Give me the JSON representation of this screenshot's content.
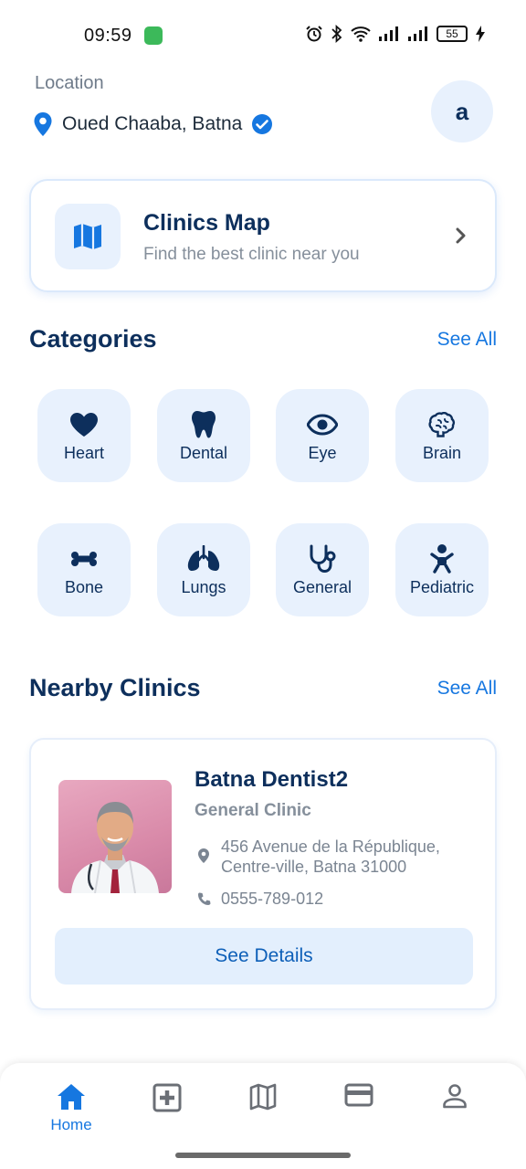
{
  "status_bar": {
    "time": "09:59",
    "battery": "55"
  },
  "header": {
    "location_label": "Location",
    "location_value": "Oued Chaaba, Batna",
    "avatar_initial": "a"
  },
  "map_card": {
    "title": "Clinics Map",
    "subtitle": "Find the best clinic near you"
  },
  "categories": {
    "title": "Categories",
    "see_all": "See All",
    "items": [
      {
        "label": "Heart",
        "icon": "heart-icon"
      },
      {
        "label": "Dental",
        "icon": "tooth-icon"
      },
      {
        "label": "Eye",
        "icon": "eye-icon"
      },
      {
        "label": "Brain",
        "icon": "brain-icon"
      },
      {
        "label": "Bone",
        "icon": "bone-icon"
      },
      {
        "label": "Lungs",
        "icon": "lungs-icon"
      },
      {
        "label": "General",
        "icon": "stethoscope-icon"
      },
      {
        "label": "Pediatric",
        "icon": "baby-icon"
      }
    ]
  },
  "nearby": {
    "title": "Nearby Clinics",
    "see_all": "See All",
    "clinic": {
      "name": "Batna Dentist2",
      "type": "General Clinic",
      "address": "456 Avenue de la République, Centre-ville, Batna 31000",
      "phone": "0555-789-012",
      "button": "See Details"
    }
  },
  "bottom_nav": {
    "items": [
      {
        "label": "Home",
        "icon": "home-icon",
        "active": true
      },
      {
        "label": "",
        "icon": "medical-plus-icon",
        "active": false
      },
      {
        "label": "",
        "icon": "map-icon",
        "active": false
      },
      {
        "label": "",
        "icon": "card-icon",
        "active": false
      },
      {
        "label": "",
        "icon": "profile-icon",
        "active": false
      }
    ]
  },
  "colors": {
    "primary": "#1677e0",
    "navy": "#0d2f5c",
    "tile": "#e8f1fd"
  }
}
